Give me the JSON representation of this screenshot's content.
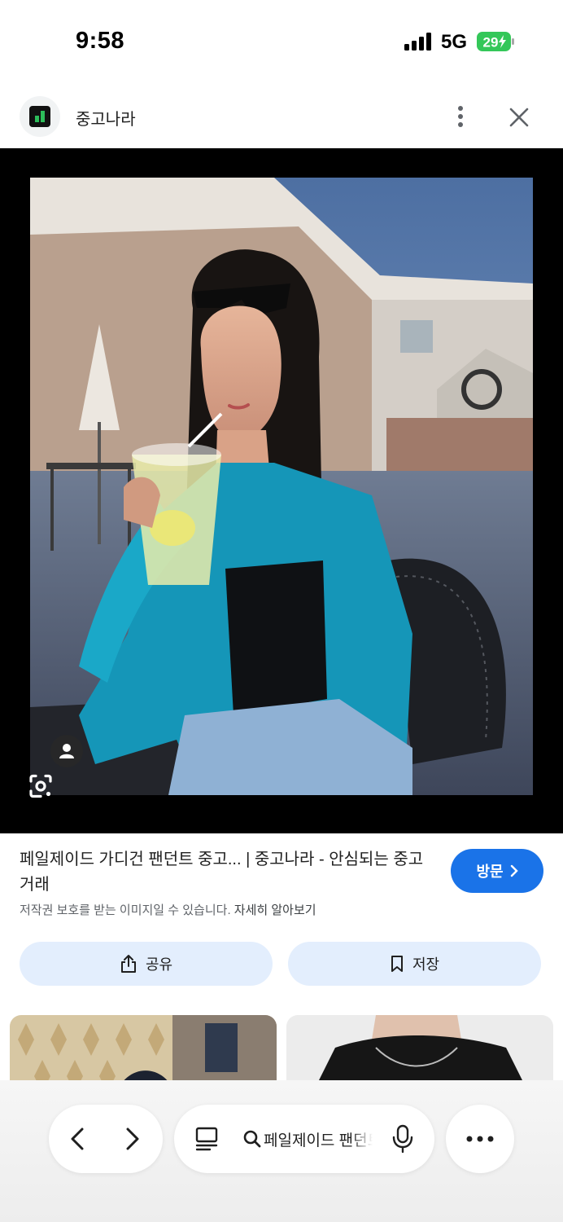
{
  "status_bar": {
    "time": "9:58",
    "network": "5G",
    "battery": "29"
  },
  "site": {
    "name": "중고나라",
    "logo_icon": "junggonara-logo-icon"
  },
  "header_actions": {
    "more_icon": "more-vert-icon",
    "close_icon": "close-icon"
  },
  "viewer": {
    "lens_icon": "google-lens-icon",
    "person_icon": "person-icon"
  },
  "result": {
    "title": "페일제이드 가디건 팬던트 중고... | 중고나라 - 안심되는 중고거래",
    "copyright": "저작권 보호를 받는 이미지일 수 있습니다.",
    "learn_more": "자세히 알아보기",
    "visit_label": "방문",
    "visit_icon": "chevron-right-icon"
  },
  "actions": {
    "share_label": "공유",
    "share_icon": "share-icon",
    "save_label": "저장",
    "save_icon": "bookmark-icon"
  },
  "toolbar": {
    "query": "페일제이드 팬던트",
    "back_icon": "chevron-left-icon",
    "forward_icon": "chevron-right-icon",
    "tabs_icon": "tabs-icon",
    "search_icon": "search-icon",
    "mic_icon": "mic-icon",
    "menu_icon": "more-horiz-icon"
  },
  "colors": {
    "accent": "#1a73e8",
    "action_bg": "#e3eefd",
    "site_logo": "#2dbd5a"
  }
}
